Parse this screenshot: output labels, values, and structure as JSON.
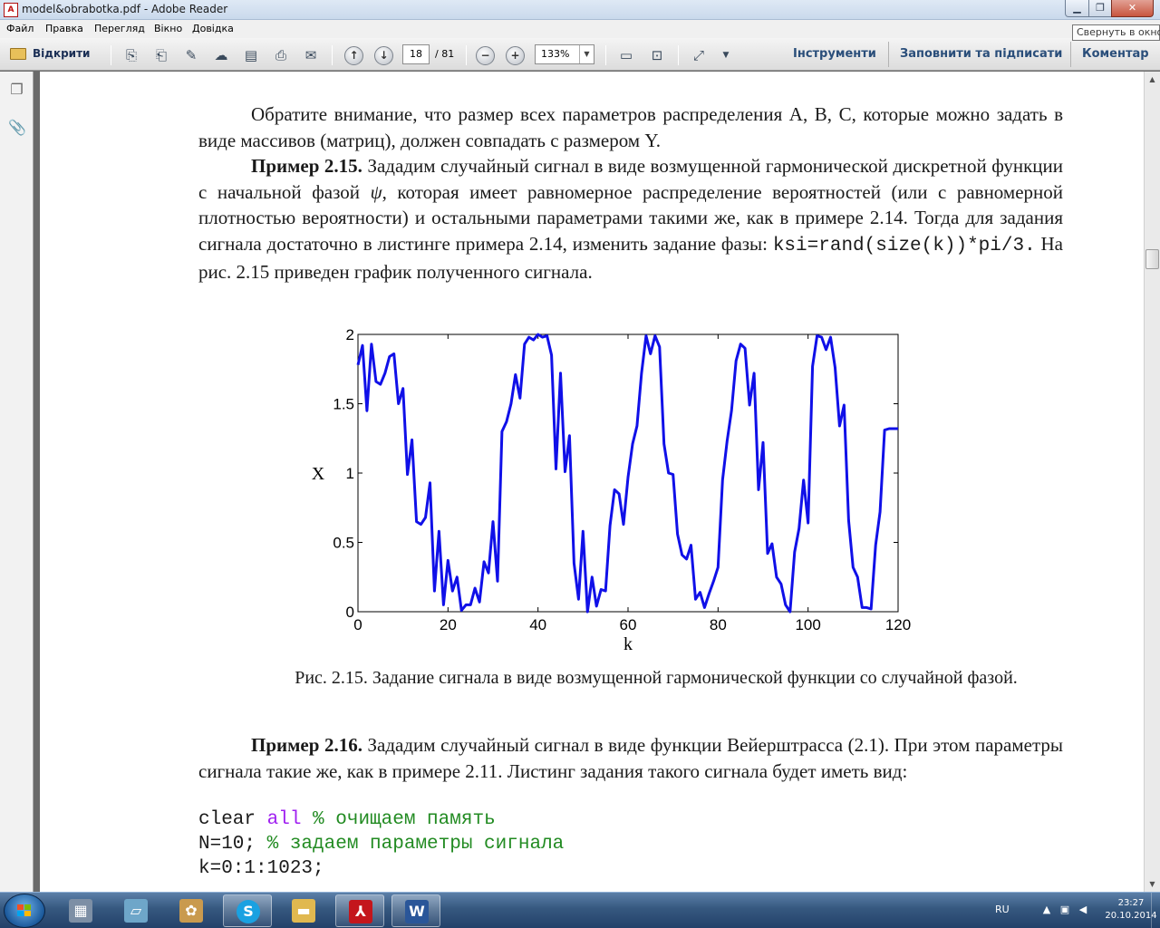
{
  "window": {
    "title": "model&obrabotka.pdf - Adobe Reader",
    "tooltip": "Свернуть в окно"
  },
  "menu": [
    "Файл",
    "Правка",
    "Перегляд",
    "Вікно",
    "Довідка"
  ],
  "toolbar": {
    "open_label": "Відкрити",
    "page_current": "18",
    "page_total": "/ 81",
    "zoom": "133%",
    "tools_label": "Інструменти",
    "fill_sign_label": "Заповнити та підписати",
    "comment_label": "Коментар"
  },
  "document": {
    "para1": "Обратите внимание, что размер всех параметров распределения A, B, C, которые можно задать в виде массивов (матриц), должен совпадать с размером Y.",
    "para2_bold": "Пример 2.15.",
    "para2_a": " Зададим случайный сигнал в виде возмущенной гармонической дискретной функции с начальной фазой ",
    "para2_psi": "ψ",
    "para2_b": ", которая имеет равномерное распределение вероятностей (или с равномерной плотностью вероятности) и остальными параметрами такими же, как в примере 2.14. Тогда для задания сигнала достаточно в листинге примера 2.14, изменить задание фазы: ",
    "para2_code": "ksi=rand(size(k))*pi/3.",
    "para2_c": " На рис. 2.15 приведен график полученного сигнала.",
    "caption": "Рис. 2.15. Задание сигнала в виде возмущенной гармонической функции со случайной фазой.",
    "para3_bold": "Пример 2.16.",
    "para3_text": " Зададим случайный сигнал в виде функции Вейерштрасса (2.1). При этом параметры сигнала такие же, как в примере 2.11. Листинг задания такого сигнала будет иметь вид:",
    "code1_a": "clear ",
    "code1_kw": "all",
    "code1_cm": " % очищаем память",
    "code2_a": "N=10;",
    "code2_cm": " % задаем параметры сигнала",
    "code3": "k=0:1:1023;"
  },
  "chart_data": {
    "type": "line",
    "xlabel": "k",
    "ylabel": "X",
    "xlim": [
      0,
      120
    ],
    "ylim": [
      0,
      2
    ],
    "xticks": [
      "0",
      "20",
      "40",
      "60",
      "80",
      "100",
      "120"
    ],
    "yticks": [
      "0",
      "0.5",
      "1",
      "1.5",
      "2"
    ],
    "grid": false,
    "line_color": "#1010e8",
    "series": [
      {
        "x": [
          0,
          1,
          2,
          3,
          4,
          5,
          6,
          7,
          8,
          9,
          10,
          11,
          12,
          13,
          14,
          15,
          16,
          17,
          18,
          19,
          20,
          21,
          22,
          23,
          24,
          25,
          26,
          27,
          28,
          29,
          30,
          31,
          32,
          33,
          34,
          35,
          36,
          37,
          38,
          39,
          40,
          41,
          42,
          43,
          44,
          45,
          46,
          47,
          48,
          49,
          50,
          51,
          52,
          53,
          54,
          55,
          56,
          57,
          58,
          59,
          60,
          61,
          62,
          63,
          64,
          65,
          66,
          67,
          68,
          69,
          70,
          71,
          72,
          73,
          74,
          75,
          76,
          77,
          78,
          79,
          80,
          81,
          82,
          83,
          84,
          85,
          86,
          87,
          88,
          89,
          90,
          91,
          92,
          93,
          94,
          95,
          96,
          97,
          98,
          99,
          100,
          101,
          102,
          103,
          104,
          105,
          106,
          107,
          108,
          109,
          110,
          111,
          112,
          113,
          114,
          115,
          116,
          117,
          118,
          119,
          120
        ],
        "y": [
          1.78,
          1.92,
          1.45,
          1.93,
          1.66,
          1.64,
          1.72,
          1.84,
          1.86,
          1.5,
          1.61,
          0.99,
          1.24,
          0.65,
          0.63,
          0.68,
          0.93,
          0.15,
          0.58,
          0.05,
          0.37,
          0.15,
          0.25,
          0.01,
          0.05,
          0.05,
          0.17,
          0.07,
          0.36,
          0.28,
          0.65,
          0.22,
          1.3,
          1.37,
          1.5,
          1.71,
          1.54,
          1.93,
          1.98,
          1.96,
          2.0,
          1.98,
          1.99,
          1.85,
          1.03,
          1.72,
          1.01,
          1.27,
          0.35,
          0.09,
          0.58,
          0.0,
          0.25,
          0.04,
          0.16,
          0.15,
          0.62,
          0.88,
          0.85,
          0.63,
          0.97,
          1.21,
          1.34,
          1.72,
          1.99,
          1.86,
          1.99,
          1.91,
          1.21,
          1.0,
          0.99,
          0.56,
          0.41,
          0.38,
          0.48,
          0.09,
          0.14,
          0.03,
          0.13,
          0.22,
          0.32,
          0.95,
          1.23,
          1.45,
          1.81,
          1.93,
          1.9,
          1.49,
          1.72,
          0.88,
          1.22,
          0.42,
          0.49,
          0.25,
          0.2,
          0.05,
          0.0,
          0.43,
          0.6,
          0.95,
          0.64,
          1.77,
          1.99,
          1.98,
          1.89,
          1.98,
          1.76,
          1.34,
          1.49,
          0.66,
          0.32,
          0.25,
          0.03,
          0.03,
          0.02,
          0.48,
          0.72,
          1.31,
          1.32,
          1.32,
          1.32
        ]
      }
    ]
  }
}
